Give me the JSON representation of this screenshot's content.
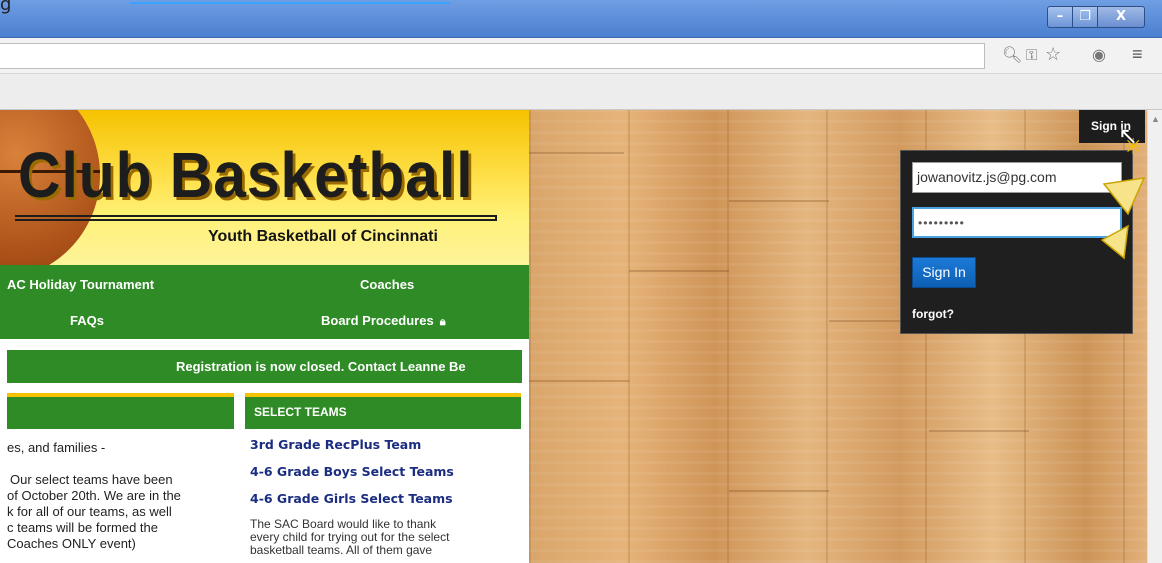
{
  "window": {
    "title_fragment": "g",
    "min_label": "–",
    "max_label": "❐",
    "close_label": "X"
  },
  "toolbar": {
    "icons": [
      "zoom-icon",
      "key-icon",
      "star-icon",
      "extension-icon",
      "menu-icon"
    ]
  },
  "site": {
    "title": "Club Basketball",
    "subtitle": "Youth Basketball of Cincinnati"
  },
  "nav": {
    "items": [
      "AC Holiday Tournament",
      "Coaches",
      "FAQs",
      "Board Procedures"
    ]
  },
  "ticker": "Registration is now closed.  Contact Leanne Be",
  "left_column": {
    "lines": [
      "es, and families -",
      "Our select teams have been",
      "of October 20th.  We are in the",
      "k for all of our teams, as well",
      "c teams will be formed the",
      "Coaches ONLY event)"
    ]
  },
  "right_column": {
    "heading": "SELECT TEAMS",
    "links": [
      "3rd Grade RecPlus Team",
      "4-6 Grade Boys Select Teams",
      "4-6 Grade Girls Select Teams"
    ],
    "text_lines": [
      "The SAC Board would like to thank",
      "every child for trying out for the select",
      "basketball teams. All of them gave"
    ]
  },
  "signin": {
    "tab_label": "Sign in",
    "email_value": "jowanovitz.js@pg.com",
    "password_value": "•••••••••",
    "button_label": "Sign In",
    "forgot_label": "forgot?"
  },
  "colors": {
    "nav_green": "#2e8b25",
    "header_yellow": "#f5c200",
    "link_blue": "#1a2d80",
    "signin_blue": "#1c7ad8"
  }
}
